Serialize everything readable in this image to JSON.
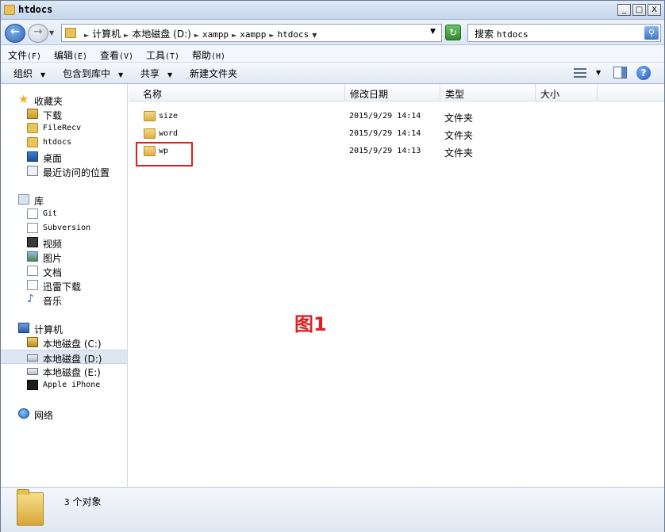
{
  "window": {
    "title": "htdocs",
    "min_label": "_",
    "max_label": "□",
    "close_label": "X"
  },
  "address": {
    "crumbs": [
      "计算机",
      "本地磁盘 (D:)",
      "xampp",
      "xampp",
      "htdocs"
    ],
    "search_label": "搜索",
    "search_scope": "htdocs"
  },
  "menu": [
    {
      "label": "文件",
      "key": "(F)"
    },
    {
      "label": "编辑",
      "key": "(E)"
    },
    {
      "label": "查看",
      "key": "(V)"
    },
    {
      "label": "工具",
      "key": "(T)"
    },
    {
      "label": "帮助",
      "key": "(H)"
    }
  ],
  "toolbar": {
    "organize": "组织",
    "include_library": "包含到库中",
    "share": "共享",
    "new_folder": "新建文件夹"
  },
  "nav": {
    "favorites": {
      "label": "收藏夹",
      "items": [
        "下载",
        "FileRecv",
        "htdocs",
        "桌面",
        "最近访问的位置"
      ]
    },
    "libraries": {
      "label": "库",
      "items": [
        "Git",
        "Subversion",
        "视频",
        "图片",
        "文档",
        "迅雷下载",
        "音乐"
      ]
    },
    "computer": {
      "label": "计算机",
      "items": [
        "本地磁盘 (C:)",
        "本地磁盘 (D:)",
        "本地磁盘 (E:)",
        "Apple iPhone"
      ]
    },
    "network": {
      "label": "网络"
    }
  },
  "columns": {
    "name": "名称",
    "date": "修改日期",
    "type": "类型",
    "size": "大小"
  },
  "files": [
    {
      "name": "size",
      "date": "2015/9/29 14:14",
      "type": "文件夹"
    },
    {
      "name": "word",
      "date": "2015/9/29 14:14",
      "type": "文件夹"
    },
    {
      "name": "wp",
      "date": "2015/9/29 14:13",
      "type": "文件夹"
    }
  ],
  "annotation": "图1",
  "status": {
    "count": "3",
    "label": "个对象"
  },
  "colors": {
    "highlight": "#e02020",
    "selected_row": "#dde6f2"
  }
}
